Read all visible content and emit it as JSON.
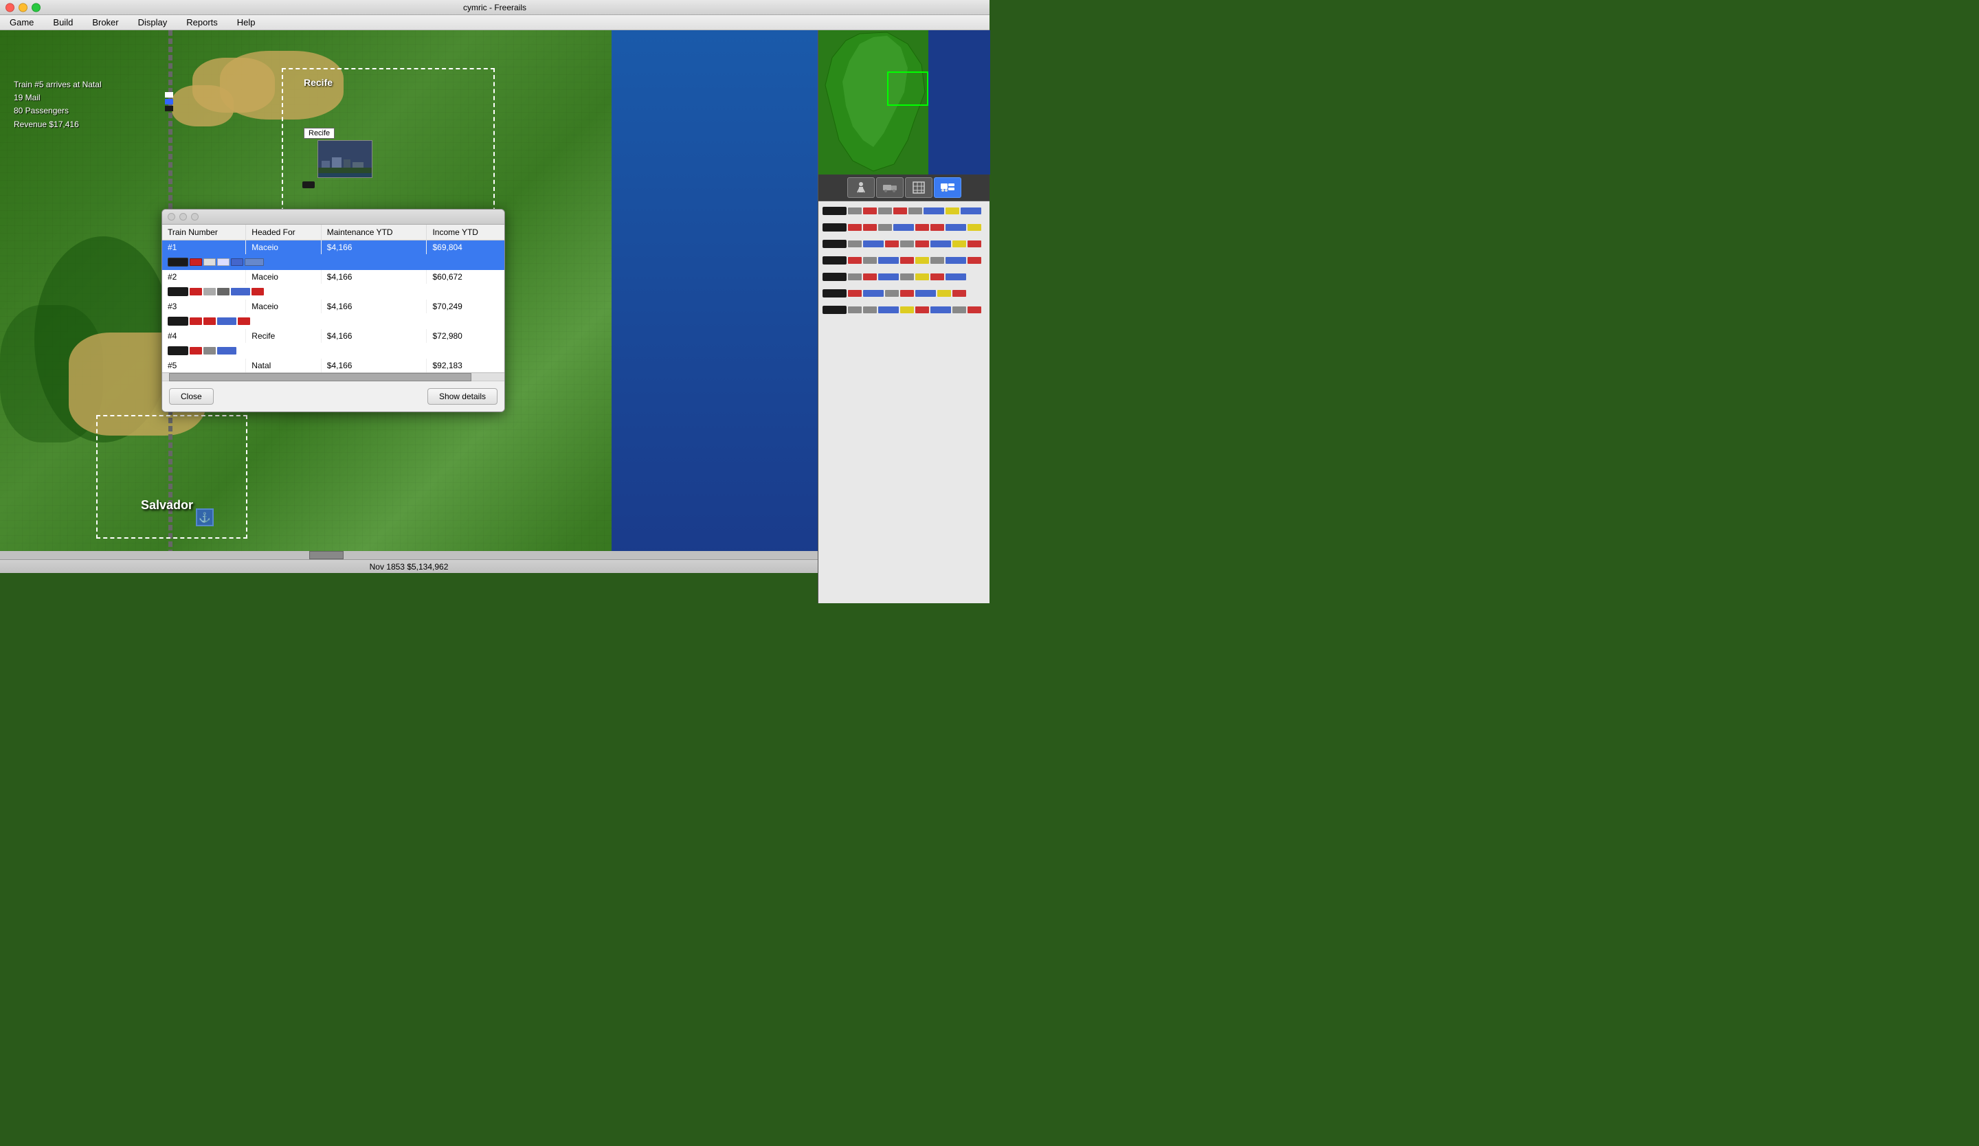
{
  "window": {
    "title": "cymric - Freerails",
    "controls": {
      "close": "●",
      "minimize": "●",
      "maximize": "●"
    }
  },
  "menu": {
    "items": [
      "Game",
      "Build",
      "Broker",
      "Display",
      "Reports",
      "Help"
    ]
  },
  "status_bar": {
    "text": "Nov 1853  $5,134,962"
  },
  "notification": {
    "line1": "Train #5 arrives at Natal",
    "line2": "19 Mail",
    "line3": "80 Passengers",
    "line4": "Revenue $17,416"
  },
  "cities": {
    "recife": "Recife",
    "salvador": "Salvador"
  },
  "train_dialog": {
    "title": "",
    "columns": {
      "train_number": "Train Number",
      "headed_for": "Headed For",
      "maintenance_ytd": "Maintenance YTD",
      "income_ytd": "Income YTD"
    },
    "trains": [
      {
        "number": "#1",
        "headed_for": "Maceio",
        "maintenance_ytd": "$4,166",
        "income_ytd": "$69,804",
        "selected": true
      },
      {
        "number": "#2",
        "headed_for": "Maceio",
        "maintenance_ytd": "$4,166",
        "income_ytd": "$60,672",
        "selected": false
      },
      {
        "number": "#3",
        "headed_for": "Maceio",
        "maintenance_ytd": "$4,166",
        "income_ytd": "$70,249",
        "selected": false
      },
      {
        "number": "#4",
        "headed_for": "Recife",
        "maintenance_ytd": "$4,166",
        "income_ytd": "$72,980",
        "selected": false
      },
      {
        "number": "#5",
        "headed_for": "Natal",
        "maintenance_ytd": "$4,166",
        "income_ytd": "$92,183",
        "selected": false
      }
    ],
    "buttons": {
      "close": "Close",
      "show_details": "Show details"
    }
  },
  "toolbar": {
    "icons": [
      "🔍",
      "🚂",
      "📊",
      "🚀"
    ]
  }
}
